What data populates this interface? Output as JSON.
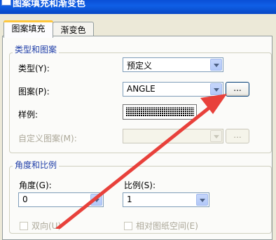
{
  "window": {
    "title": "图案填充和渐变色"
  },
  "tabs": [
    {
      "label": "图案填充",
      "active": true
    },
    {
      "label": "渐变色",
      "active": false
    }
  ],
  "type_pattern_group": {
    "title": "类型和图案",
    "type_label": "类型(Y):",
    "type_value": "预定义",
    "pattern_label": "图案(P):",
    "pattern_value": "ANGLE",
    "browse_label": "...",
    "swatch_label": "样例:",
    "custom_label": "自定义图案(M):",
    "custom_value": "",
    "custom_browse_label": "..."
  },
  "angle_scale_group": {
    "title": "角度和比例",
    "angle_label": "角度(G):",
    "angle_value": "0",
    "scale_label": "比例(S):",
    "scale_value": "1",
    "double_label": "双向(U)",
    "relative_label": "相对图纸空间(E)"
  },
  "colors": {
    "annotation_arrow": "#e8413b",
    "group_title": "#1f3ea8",
    "titlebar": "#0a4fd6"
  }
}
